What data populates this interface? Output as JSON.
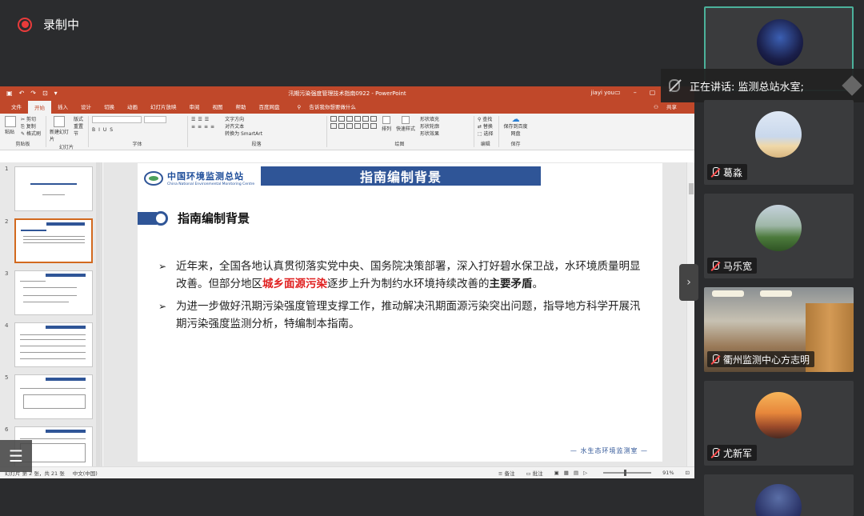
{
  "recording": {
    "label": "录制中"
  },
  "ppt": {
    "window_title": "汛期污染强度管理技术指南0922 - PowerPoint",
    "user": "jiayi you",
    "qat": [
      "↶",
      "↷",
      "⊡",
      "▾"
    ],
    "tabs": [
      "文件",
      "开始",
      "插入",
      "设计",
      "切换",
      "动画",
      "幻灯片放映",
      "审阅",
      "视图",
      "帮助",
      "百度网盘"
    ],
    "active_tab_index": 1,
    "tell_me": "告诉我你想要做什么",
    "share": "共享",
    "ribbon": {
      "clipboard": {
        "label": "剪贴板",
        "items": [
          "剪切",
          "复制",
          "格式刷"
        ],
        "paste": "粘贴"
      },
      "slides": {
        "label": "幻灯片",
        "new": "新建幻灯片",
        "items": [
          "版式",
          "重置",
          "节"
        ]
      },
      "font": {
        "label": "字体"
      },
      "paragraph": {
        "label": "段落",
        "items": [
          "文字方向",
          "对齐文本",
          "转换为 SmartArt"
        ]
      },
      "drawing": {
        "label": "绘图",
        "arrange": "排列",
        "quick_styles": "快速样式",
        "items": [
          "形状填充",
          "形状轮廓",
          "形状效果"
        ]
      },
      "editing": {
        "label": "编辑",
        "items": [
          "查找",
          "替换",
          "选择"
        ]
      },
      "save": {
        "label": "保存",
        "btn": "保存到百度网盘"
      }
    },
    "thumbnails": [
      {
        "num": "1"
      },
      {
        "num": "2"
      },
      {
        "num": "3"
      },
      {
        "num": "4"
      },
      {
        "num": "5"
      },
      {
        "num": "6"
      }
    ],
    "selected_thumbnail": 2,
    "slide": {
      "org_cn": "中国环境监测总站",
      "org_en": "China National Environmental Monitoring Centre",
      "title": "指南编制背景",
      "heading": "指南编制背景",
      "bullet_symbol": "➢",
      "p1_a": "近年来，全国各地认真贯彻落实党中央、国务院决策部署，深入打好碧水保卫战，水环境质量明显改善。但部分地区",
      "p1_red": "城乡面源污染",
      "p1_b": "逐步上升为制约水环境持续改善的",
      "p1_bold": "主要矛盾",
      "p1_end": "。",
      "p2": "为进一步做好汛期污染强度管理支撑工作，推动解决汛期面源污染突出问题，指导地方科学开展汛期污染强度监测分析，特编制本指南。",
      "footer": "— 水生态环境监测室 —"
    },
    "status": {
      "slide_info": "幻灯片 第 2 张，共 21 张",
      "lang": "中文(中国)",
      "notes": "备注",
      "comments": "批注",
      "zoom": "91%"
    }
  },
  "speaking": {
    "label": "正在讲话: 监测总站水室;"
  },
  "participants": [
    {
      "name": ""
    },
    {
      "name": "葛淼"
    },
    {
      "name": "马乐宽"
    },
    {
      "name": "衢州监测中心方志明"
    },
    {
      "name": "尤新军"
    },
    {
      "name": ""
    }
  ],
  "colors": {
    "ppt_accent": "#c0482a",
    "slide_blue": "#2f5597",
    "highlight_red": "#e02020",
    "active_border": "#4bb29b",
    "record_red": "#e83b3b"
  }
}
